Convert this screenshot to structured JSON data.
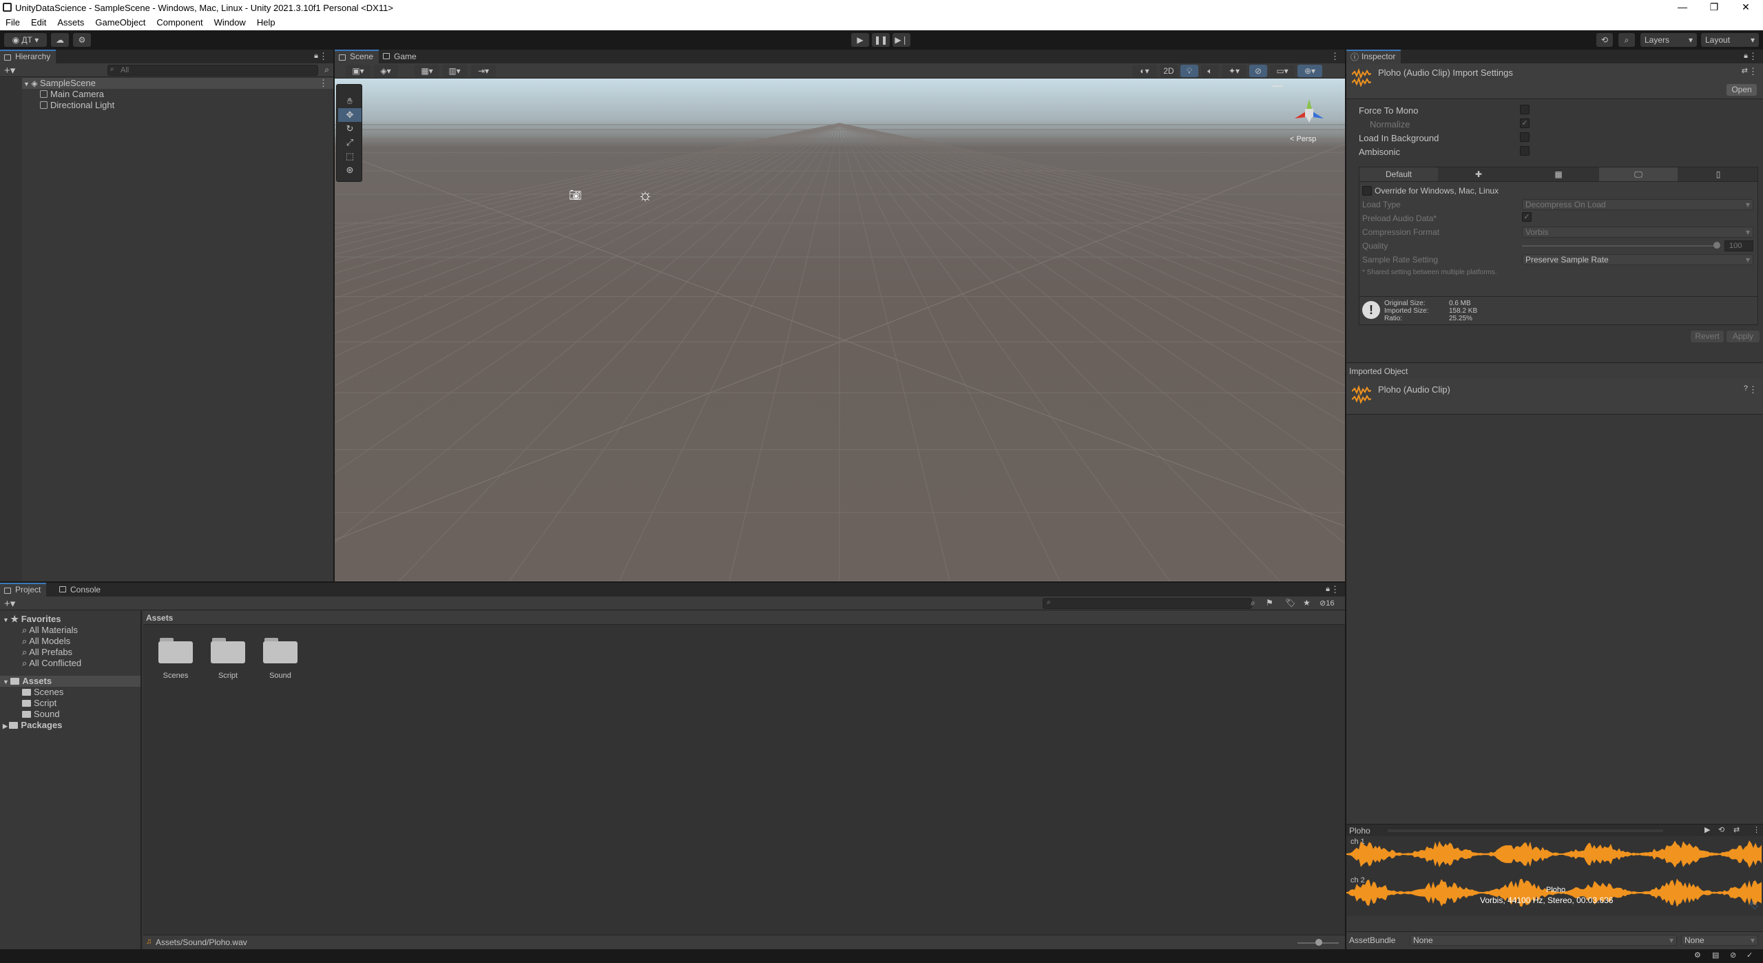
{
  "window": {
    "title": "UnityDataScience - SampleScene - Windows, Mac, Linux - Unity 2021.3.10f1 Personal <DX11>",
    "minimize": "—",
    "maximize": "❐",
    "close": "✕"
  },
  "menu": [
    "File",
    "Edit",
    "Assets",
    "GameObject",
    "Component",
    "Window",
    "Help"
  ],
  "toolbar": {
    "account_label": "ДТ",
    "play_icon": "play-icon",
    "pause_icon": "pause-icon",
    "step_icon": "step-icon",
    "layers_label": "Layers",
    "layout_label": "Layout"
  },
  "hierarchy": {
    "tab": "Hierarchy",
    "search_placeholder": "All",
    "scene": "SampleScene",
    "items": [
      "Main Camera",
      "Directional Light"
    ]
  },
  "scene_view": {
    "tabs": [
      "Scene",
      "Game"
    ],
    "two_d_label": "2D",
    "persp_label": "< Persp",
    "tools": [
      "hand-tool",
      "move-tool",
      "rotate-tool",
      "scale-tool",
      "rect-tool",
      "transform-tool"
    ]
  },
  "inspector": {
    "tab": "Inspector",
    "header_title": "Ploho (Audio Clip) Import Settings",
    "open_button": "Open",
    "force_to_mono": "Force To Mono",
    "normalize": "Normalize",
    "load_in_background": "Load In Background",
    "ambisonic": "Ambisonic",
    "platform_tabs": [
      "Default"
    ],
    "override_label": "Override for Windows, Mac, Linux",
    "load_type_label": "Load Type",
    "load_type_value": "Decompress On Load",
    "preload_label": "Preload Audio Data*",
    "compression_label": "Compression Format",
    "compression_value": "Vorbis",
    "quality_label": "Quality",
    "quality_value": "100",
    "sample_rate_label": "Sample Rate Setting",
    "sample_rate_value": "Preserve Sample Rate",
    "shared_note": "* Shared setting between multiple platforms.",
    "original_size_label": "Original Size:",
    "original_size_value": "0.6 MB",
    "imported_size_label": "Imported Size:",
    "imported_size_value": "158.2 KB",
    "ratio_label": "Ratio:",
    "ratio_value": "25.25%",
    "revert_button": "Revert",
    "apply_button": "Apply",
    "imported_object_header": "Imported Object",
    "imported_object_name": "Ploho (Audio Clip)",
    "preview_title": "Ploho",
    "channel1": "ch 1",
    "channel2": "ch 2",
    "clip_name_overlay": "Ploho",
    "clip_info": "Vorbis, 44100 Hz, Stereo, 00:03.636",
    "assetbundle_label": "AssetBundle",
    "assetbundle_value": "None",
    "assetbundle_variant": "None"
  },
  "project": {
    "tabs": [
      "Project",
      "Console"
    ],
    "hidden_count": "16",
    "favorites_label": "Favorites",
    "favorites": [
      "All Materials",
      "All Models",
      "All Prefabs",
      "All Conflicted"
    ],
    "assets_label": "Assets",
    "asset_folders": [
      "Scenes",
      "Script",
      "Sound"
    ],
    "packages_label": "Packages",
    "breadcrumb": "Assets",
    "grid_items": [
      "Scenes",
      "Script",
      "Sound"
    ],
    "status_path": "Assets/Sound/Ploho.wav"
  },
  "colors": {
    "accent": "#3a79bb",
    "waveform": "#f0931f",
    "panel": "#383838",
    "dark": "#191919"
  }
}
